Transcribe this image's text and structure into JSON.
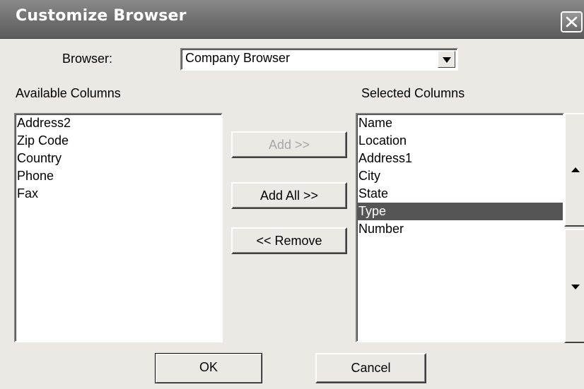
{
  "window": {
    "title": "Customize Browser"
  },
  "browser": {
    "label": "Browser:",
    "selected": "Company Browser"
  },
  "available": {
    "label": "Available Columns",
    "items": [
      "Address2",
      "Zip Code",
      "Country",
      "Phone",
      "Fax"
    ]
  },
  "selected": {
    "label": "Selected Columns",
    "items": [
      "Name",
      "Location",
      "Address1",
      "City",
      "State",
      "Type",
      "Number"
    ],
    "highlighted": "Type"
  },
  "buttons": {
    "add": "Add >>",
    "add_all": "Add All >>",
    "remove": "<< Remove",
    "ok": "OK",
    "cancel": "Cancel"
  },
  "icons": {
    "close": "close-icon",
    "dropdown": "chevron-down-icon",
    "move_up": "arrow-up-icon",
    "move_down": "arrow-down-icon"
  },
  "colors": {
    "titlebar": "#6e6e6e",
    "selection": "#555555",
    "dialog_bg": "#ece9e4"
  }
}
